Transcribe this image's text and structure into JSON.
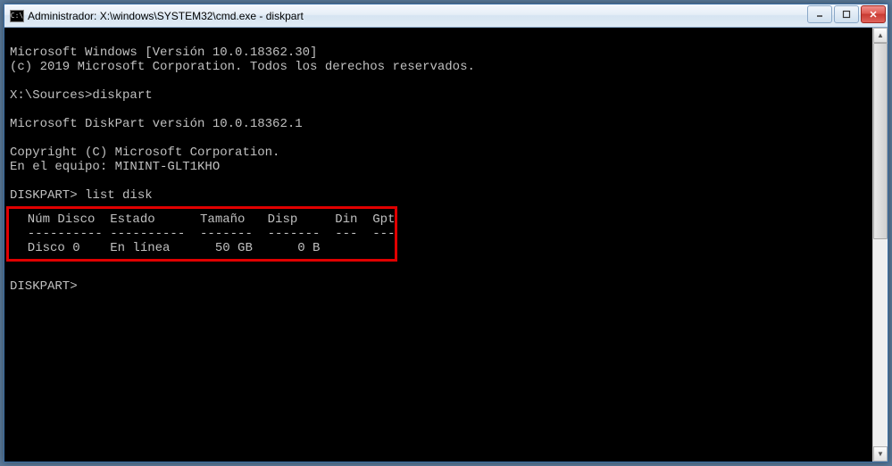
{
  "window": {
    "icon_label": "C:\\",
    "title": "Administrador: X:\\windows\\SYSTEM32\\cmd.exe - diskpart"
  },
  "console": {
    "line1": "Microsoft Windows [Versión 10.0.18362.30]",
    "line2": "(c) 2019 Microsoft Corporation. Todos los derechos reservados.",
    "blank": "",
    "prompt1": "X:\\Sources>diskpart",
    "dp_version": "Microsoft DiskPart versión 10.0.18362.1",
    "copyright": "Copyright (C) Microsoft Corporation.",
    "equipo": "En el equipo: MININT-GLT1KHO",
    "prompt2": "DISKPART> list disk",
    "table_header": "  Núm Disco  Estado      Tamaño   Disp     Din  Gpt",
    "table_divider": "  ---------- ----------  -------  -------  ---  ---",
    "table_row1": "  Disco 0    En línea      50 GB      0 B",
    "prompt3": "DISKPART>"
  },
  "chart_data": {
    "type": "table",
    "title": "list disk",
    "columns": [
      "Núm Disco",
      "Estado",
      "Tamaño",
      "Disp",
      "Din",
      "Gpt"
    ],
    "rows": [
      {
        "Núm Disco": "Disco 0",
        "Estado": "En línea",
        "Tamaño": "50 GB",
        "Disp": "0 B",
        "Din": "",
        "Gpt": ""
      }
    ]
  }
}
